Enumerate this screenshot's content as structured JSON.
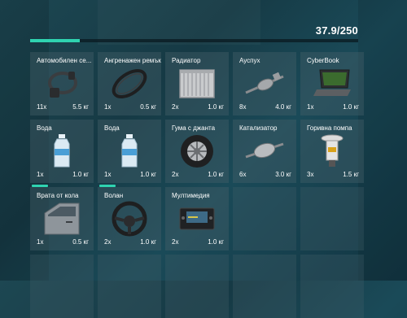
{
  "weight": {
    "label": "37.9/250",
    "current": 37.9,
    "max": 250
  },
  "colors": {
    "accent": "#2fd3b0",
    "background": "#1a4350"
  },
  "items": [
    {
      "name": "Автомобилен се...",
      "qty": "11x",
      "weight": "5.5 кг",
      "icon": "car-seat-icon"
    },
    {
      "name": "Ангренажен ремък",
      "qty": "1x",
      "weight": "0.5 кг",
      "icon": "timing-belt-icon"
    },
    {
      "name": "Радиатор",
      "qty": "2x",
      "weight": "1.0 кг",
      "icon": "radiator-icon"
    },
    {
      "name": "Ауспух",
      "qty": "8x",
      "weight": "4.0 кг",
      "icon": "exhaust-icon"
    },
    {
      "name": "CyberBook",
      "qty": "1x",
      "weight": "1.0 кг",
      "icon": "laptop-icon"
    },
    {
      "name": "Вода",
      "qty": "1x",
      "weight": "1.0 кг",
      "icon": "water-bottle-icon",
      "durability": 1.0
    },
    {
      "name": "Вода",
      "qty": "1x",
      "weight": "1.0 кг",
      "icon": "water-bottle-icon",
      "durability": 1.0
    },
    {
      "name": "Гума с джанта",
      "qty": "2x",
      "weight": "1.0 кг",
      "icon": "tire-icon"
    },
    {
      "name": "Катализатор",
      "qty": "6x",
      "weight": "3.0 кг",
      "icon": "catalytic-converter-icon"
    },
    {
      "name": "Горивна помпа",
      "qty": "3x",
      "weight": "1.5 кг",
      "icon": "fuel-pump-icon"
    },
    {
      "name": "Врата от кола",
      "qty": "1x",
      "weight": "0.5 кг",
      "icon": "car-door-icon"
    },
    {
      "name": "Волан",
      "qty": "2x",
      "weight": "1.0 кг",
      "icon": "steering-wheel-icon"
    },
    {
      "name": "Мултимедия",
      "qty": "2x",
      "weight": "1.0 кг",
      "icon": "multimedia-icon"
    }
  ]
}
